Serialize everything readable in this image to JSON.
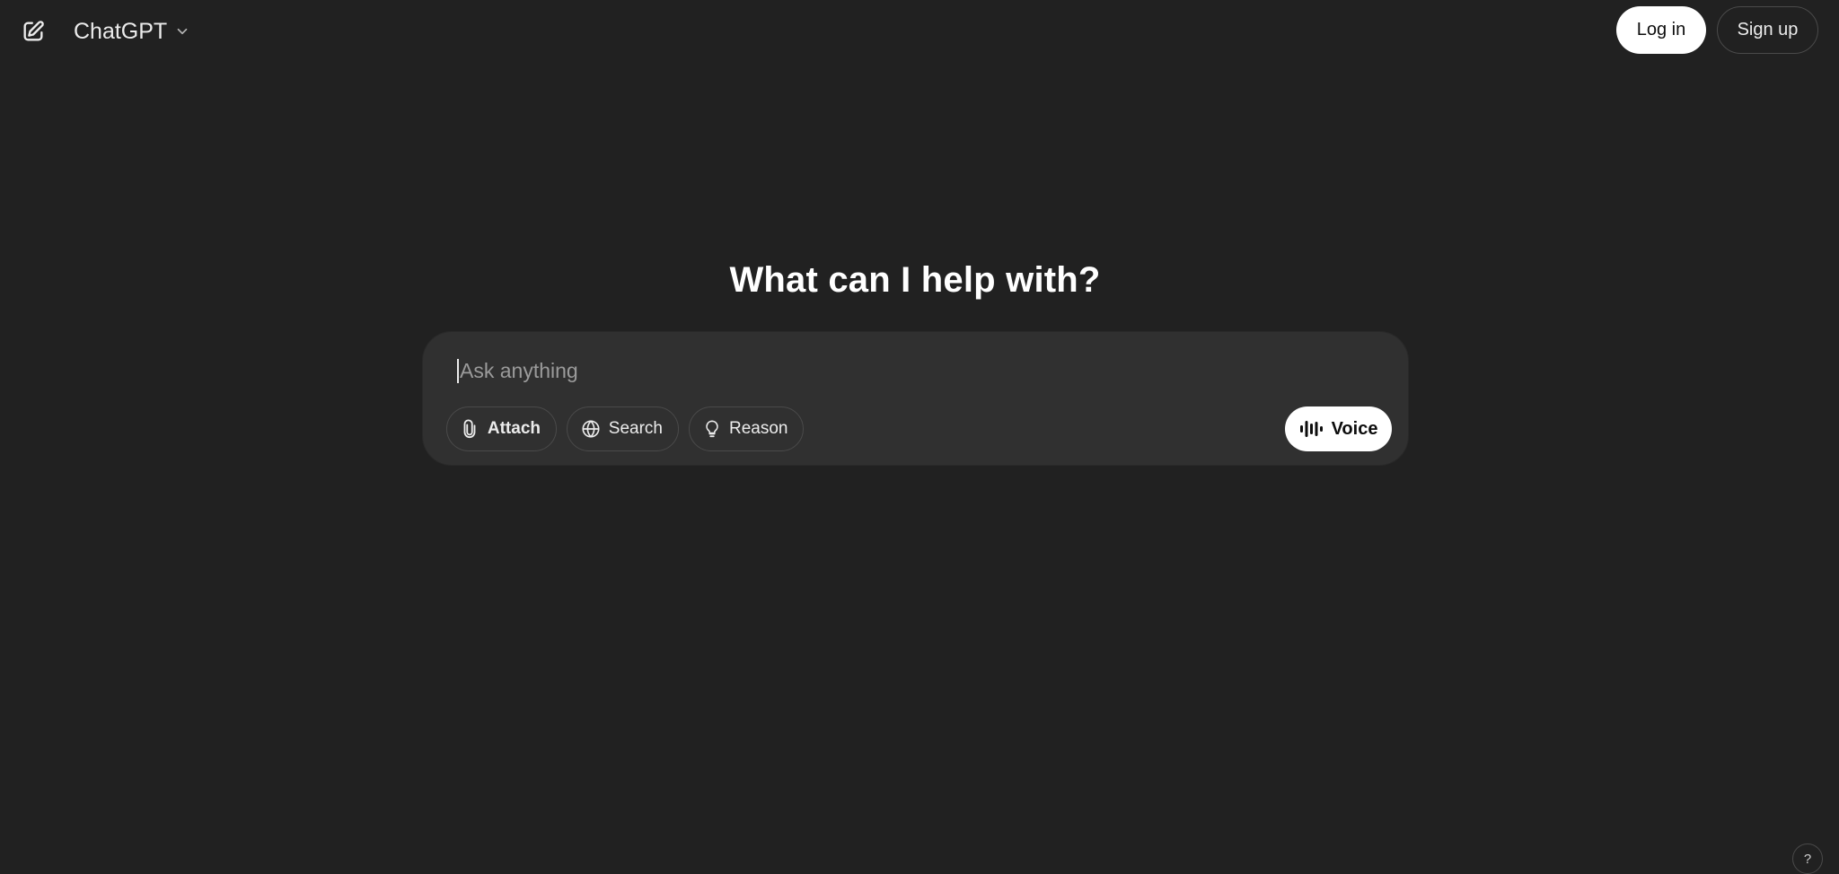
{
  "header": {
    "new_chat_icon": "compose-icon",
    "model_name": "ChatGPT",
    "model_chevron_icon": "chevron-down-icon",
    "login_label": "Log in",
    "signup_label": "Sign up"
  },
  "main": {
    "headline": "What can I help with?",
    "composer": {
      "placeholder": "Ask anything",
      "actions": [
        {
          "label": "Attach",
          "icon": "paperclip-icon"
        },
        {
          "label": "Search",
          "icon": "globe-icon"
        },
        {
          "label": "Reason",
          "icon": "lightbulb-icon"
        }
      ],
      "voice_label": "Voice",
      "voice_icon": "waveform-icon"
    }
  },
  "footer": {
    "help_label": "?"
  },
  "colors": {
    "background": "#212121",
    "composer": "#303030",
    "primary_button": "#ffffff",
    "text": "#ececec"
  }
}
